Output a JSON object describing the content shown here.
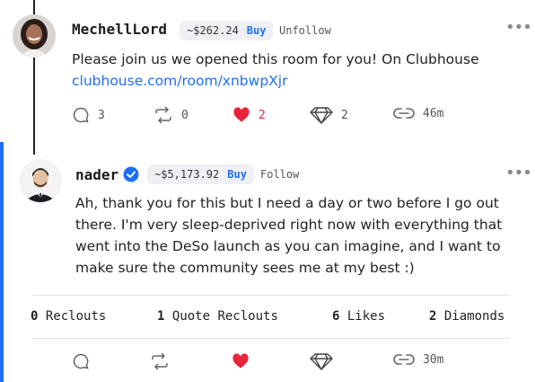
{
  "post1": {
    "username": "MechellLord",
    "price": "~$262.24",
    "buy_label": "Buy",
    "follow_label": "Unfollow",
    "text": "Please join us we opened this room for you! On Clubhouse",
    "link": "clubhouse.com/room/xnbwpXjr",
    "stats": {
      "comments": "3",
      "reclouts": "0",
      "likes": "2",
      "diamonds": "2",
      "time": "46m"
    }
  },
  "post2": {
    "username": "nader",
    "price": "~$5,173.92",
    "buy_label": "Buy",
    "follow_label": "Follow",
    "text": "Ah, thank you for this but I need a day or two before I go out there. I'm very sleep-deprived right now with everything that went into the DeSo launch as you can imagine, and I want to make sure the community sees me at my best :)",
    "counts": {
      "reclouts_num": "0",
      "reclouts_label": "Reclouts",
      "quote_num": "1",
      "quote_label": "Quote Reclouts",
      "likes_num": "6",
      "likes_label": "Likes",
      "diamonds_num": "2",
      "diamonds_label": "Diamonds"
    },
    "time": "30m"
  },
  "colors": {
    "accent": "#1f6ff5",
    "heart": "#e8233a"
  },
  "icons": [
    "more-icon",
    "comment-icon",
    "reclout-icon",
    "heart-icon",
    "diamond-icon",
    "link-icon",
    "verified-icon"
  ]
}
